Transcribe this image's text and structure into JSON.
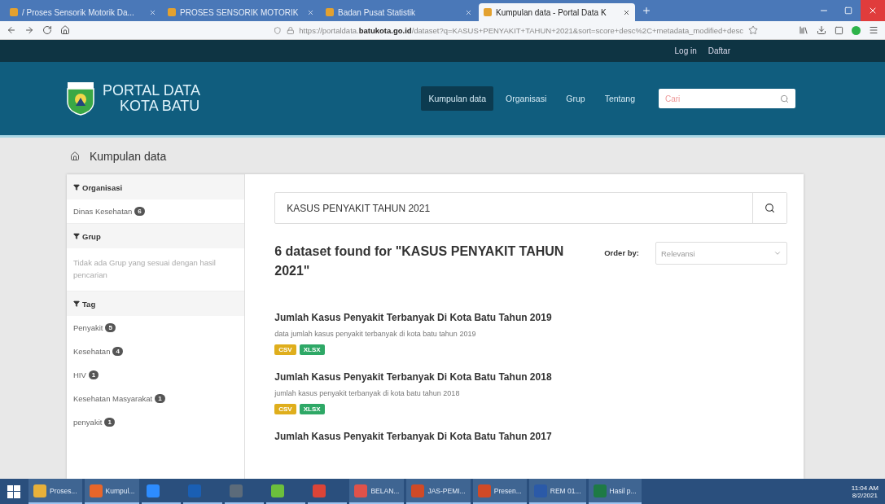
{
  "browser_tabs": [
    {
      "label": "/ Proses Sensorik Motorik Da...",
      "selected": false
    },
    {
      "label": "PROSES SENSORIK MOTORIK",
      "selected": false
    },
    {
      "label": "Badan Pusat Statistik",
      "selected": false
    },
    {
      "label": "Kumpulan data - Portal Data K",
      "selected": true
    }
  ],
  "address_bar": {
    "url_prefix": "https://portaldata.",
    "url_domain": "batukota.go.id",
    "url_rest": "/dataset?q=KASUS+PENYAKIT+TAHUN+2021&sort=score+desc%2C+metadata_modified+desc"
  },
  "top_links": [
    "Log in",
    "Daftar"
  ],
  "site": {
    "title_line1": "PORTAL DATA",
    "title_line2": "KOTA BATU"
  },
  "nav": [
    {
      "label": "Kumpulan data",
      "selected": true
    },
    {
      "label": "Organisasi",
      "selected": false
    },
    {
      "label": "Grup",
      "selected": false
    },
    {
      "label": "Tentang",
      "selected": false
    }
  ],
  "site_search": {
    "placeholder": "Cari"
  },
  "breadcrumb": "Kumpulan data",
  "sidebar": [
    {
      "title": "Organisasi",
      "items": [
        {
          "label": "Dinas Kesehatan",
          "count": "6"
        }
      ]
    },
    {
      "title": "Grup",
      "note": "Tidak ada Grup yang sesuai dengan hasil pencarian"
    },
    {
      "title": "Tag",
      "items": [
        {
          "label": "Penyakit",
          "count": "5"
        },
        {
          "label": "Kesehatan",
          "count": "4"
        },
        {
          "label": "HIV",
          "count": "1"
        },
        {
          "label": "Kesehatan Masyarakat",
          "count": "1"
        },
        {
          "label": "penyakit",
          "count": "1"
        }
      ]
    }
  ],
  "search": {
    "value": "KASUS PENYAKIT TAHUN 2021"
  },
  "results_heading": "6 dataset found for \"KASUS PENYAKIT TAHUN 2021\"",
  "order_by": {
    "label": "Order by:",
    "value": "Relevansi"
  },
  "datasets": [
    {
      "title": "Jumlah Kasus Penyakit Terbanyak Di Kota Batu Tahun 2019",
      "description": "data jumlah kasus penyakit terbanyak di kota batu tahun 2019",
      "formats": [
        {
          "label": "CSV",
          "kind": "csv"
        },
        {
          "label": "XLSX",
          "kind": "xlsx"
        }
      ]
    },
    {
      "title": "Jumlah Kasus Penyakit Terbanyak Di Kota Batu Tahun 2018",
      "description": "jumlah kasus penyakit terbanyak di kota batu tahun 2018",
      "formats": [
        {
          "label": "CSV",
          "kind": "csv"
        },
        {
          "label": "XLSX",
          "kind": "xlsx"
        }
      ]
    },
    {
      "title": "Jumlah Kasus Penyakit Terbanyak Di Kota Batu Tahun 2017"
    }
  ],
  "taskbar": {
    "apps": [
      {
        "label": "Proses...",
        "color": "#e8b13a"
      },
      {
        "label": "Kumpul...",
        "color": "#e8662a"
      },
      {
        "color": "#2d8cff"
      },
      {
        "color": "#1a5fb4"
      },
      {
        "color": "#5c6b7a"
      },
      {
        "color": "#6cbf3c"
      },
      {
        "color": "#db4437"
      },
      {
        "label": "BELAN...",
        "color": "#e0524a"
      },
      {
        "label": "JAS-PEMI...",
        "color": "#d04a26"
      },
      {
        "label": "Presen...",
        "color": "#d04a26"
      },
      {
        "label": "REM 01...",
        "color": "#2b5aa8"
      },
      {
        "label": "Hasil p...",
        "color": "#1e7a45"
      }
    ],
    "time": "11:04 AM",
    "date": "8/2/2021"
  }
}
